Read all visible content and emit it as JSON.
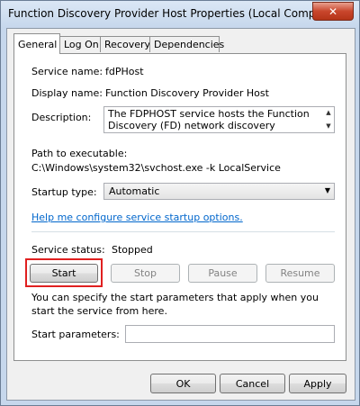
{
  "window": {
    "title": "Function Discovery Provider Host Properties (Local Computer)",
    "close_glyph": "✕"
  },
  "tabs": [
    {
      "label": "General",
      "active": true
    },
    {
      "label": "Log On",
      "active": false
    },
    {
      "label": "Recovery",
      "active": false
    },
    {
      "label": "Dependencies",
      "active": false
    }
  ],
  "general": {
    "service_name_label": "Service name:",
    "service_name_value": "fdPHost",
    "display_name_label": "Display name:",
    "display_name_value": "Function Discovery Provider Host",
    "description_label": "Description:",
    "description_value": "The FDPHOST service hosts the Function Discovery (FD) network discovery providers. These",
    "path_label": "Path to executable:",
    "path_value": "C:\\Windows\\system32\\svchost.exe -k LocalService",
    "startup_type_label": "Startup type:",
    "startup_type_value": "Automatic",
    "help_link": "Help me configure service startup options.",
    "service_status_label": "Service status:",
    "service_status_value": "Stopped",
    "buttons": {
      "start": "Start",
      "stop": "Stop",
      "pause": "Pause",
      "resume": "Resume"
    },
    "start_params_note": "You can specify the start parameters that apply when you start the service from here.",
    "start_params_label": "Start parameters:",
    "start_params_value": ""
  },
  "footer": {
    "ok": "OK",
    "cancel": "Cancel",
    "apply": "Apply"
  },
  "colors": {
    "highlight": "#e02020",
    "link": "#0066cc"
  }
}
